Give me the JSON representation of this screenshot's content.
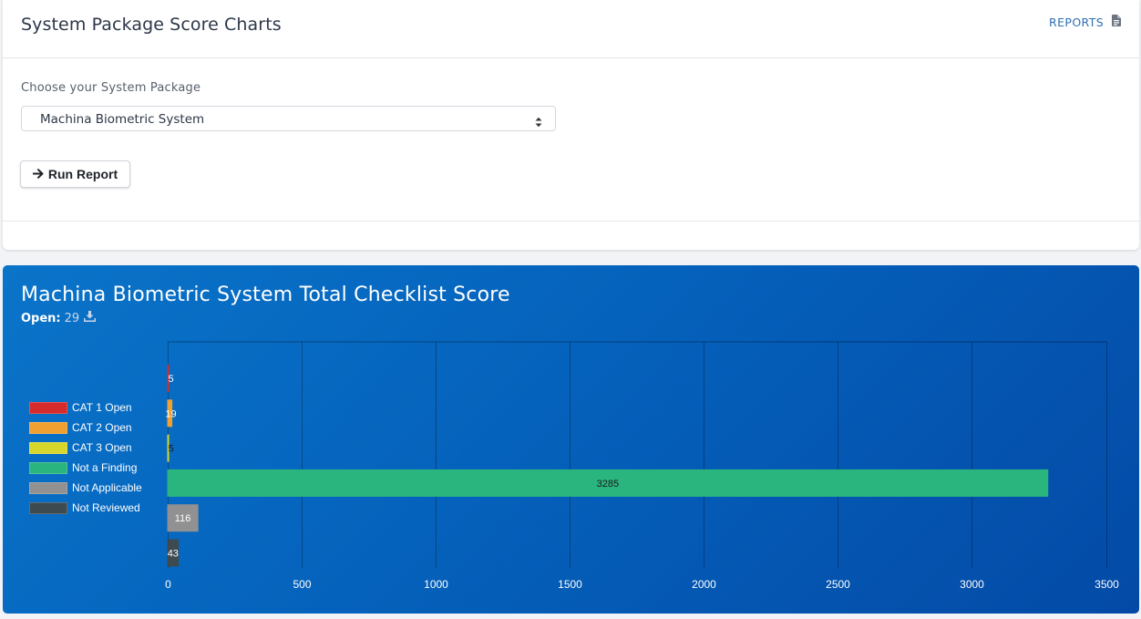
{
  "header": {
    "title": "System Package Score Charts",
    "reports_link": "REPORTS",
    "reports_icon": "document-icon"
  },
  "form": {
    "label": "Choose your System Package",
    "selected_package": "Machina Biometric System",
    "run_button": "Run Report",
    "run_icon": "arrow-right-icon"
  },
  "chart_card": {
    "title": "Machina Biometric System Total Checklist Score",
    "open_label": "Open:",
    "open_value": "29",
    "download_icon": "download-icon",
    "background": "#0562bc"
  },
  "chart_data": {
    "type": "bar",
    "orientation": "horizontal",
    "title": "Machina Biometric System Total Checklist Score",
    "xlabel": "",
    "ylabel": "",
    "xlim": [
      0,
      3500
    ],
    "x_ticks": [
      0,
      500,
      1000,
      1500,
      2000,
      2500,
      3000,
      3500
    ],
    "grid": true,
    "legend_position": "left",
    "categories": [
      "CAT 1 Open",
      "CAT 2 Open",
      "CAT 3 Open",
      "Not a Finding",
      "Not Applicable",
      "Not Reviewed"
    ],
    "values": [
      5,
      19,
      5,
      3285,
      116,
      43
    ],
    "colors": [
      "#d62b2b",
      "#f0a030",
      "#d6d62b",
      "#2bb57e",
      "#919191",
      "#3d4a4f"
    ],
    "label_colors": [
      "#ffffff",
      "#ffffff",
      "#1a1a1a",
      "#1a1a1a",
      "#ffffff",
      "#ffffff"
    ]
  }
}
